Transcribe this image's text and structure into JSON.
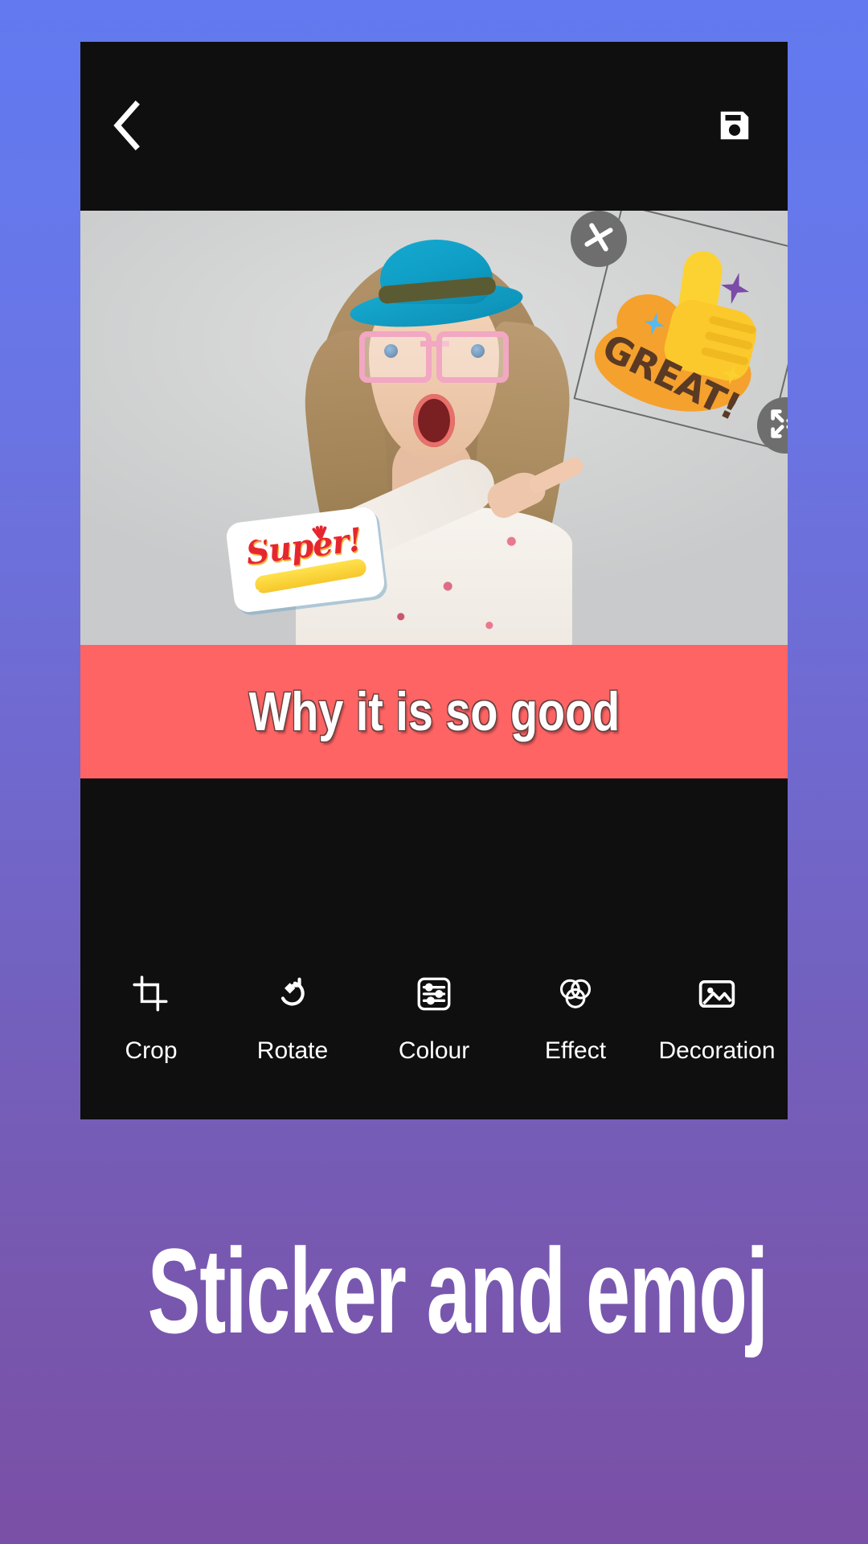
{
  "theme": {
    "bg_gradient_top": "#6279EF",
    "bg_gradient_bottom": "#7A4FA6",
    "panel_bg": "#0F0F0F",
    "caption_bar_color": "#FF6464",
    "accent_white": "#FFFFFF",
    "handle_color": "#6E6E6E"
  },
  "editor": {
    "topbar": {
      "back_icon": "chevron-left-icon",
      "save_icon": "save-floppy-icon"
    },
    "canvas": {
      "photo_description": "woman-with-teal-hat-and-pink-glasses",
      "stickers": [
        {
          "id": "super",
          "text": "Super!",
          "selected": false,
          "colors": {
            "text": "#E6262F",
            "bar": "#FFE24C",
            "plate": "#FFFFFF"
          }
        },
        {
          "id": "great",
          "text": "GREAT!",
          "selected": true,
          "colors": {
            "text": "#5A3A24",
            "cloud": "#F5A12D",
            "thumb": "#FBC92C"
          },
          "handles": {
            "delete_icon": "close-x-icon",
            "resize_icon": "resize-arrows-icon"
          }
        }
      ]
    },
    "caption": {
      "text": "Why it is so good"
    },
    "tools": [
      {
        "label": "Crop",
        "icon": "crop-icon"
      },
      {
        "label": "Rotate",
        "icon": "rotate-icon"
      },
      {
        "label": "Colour",
        "icon": "sliders-icon"
      },
      {
        "label": "Effect",
        "icon": "venn-circles-icon"
      },
      {
        "label": "Decoration",
        "icon": "image-icon"
      }
    ]
  },
  "promo": {
    "headline": "Sticker and emoj"
  }
}
